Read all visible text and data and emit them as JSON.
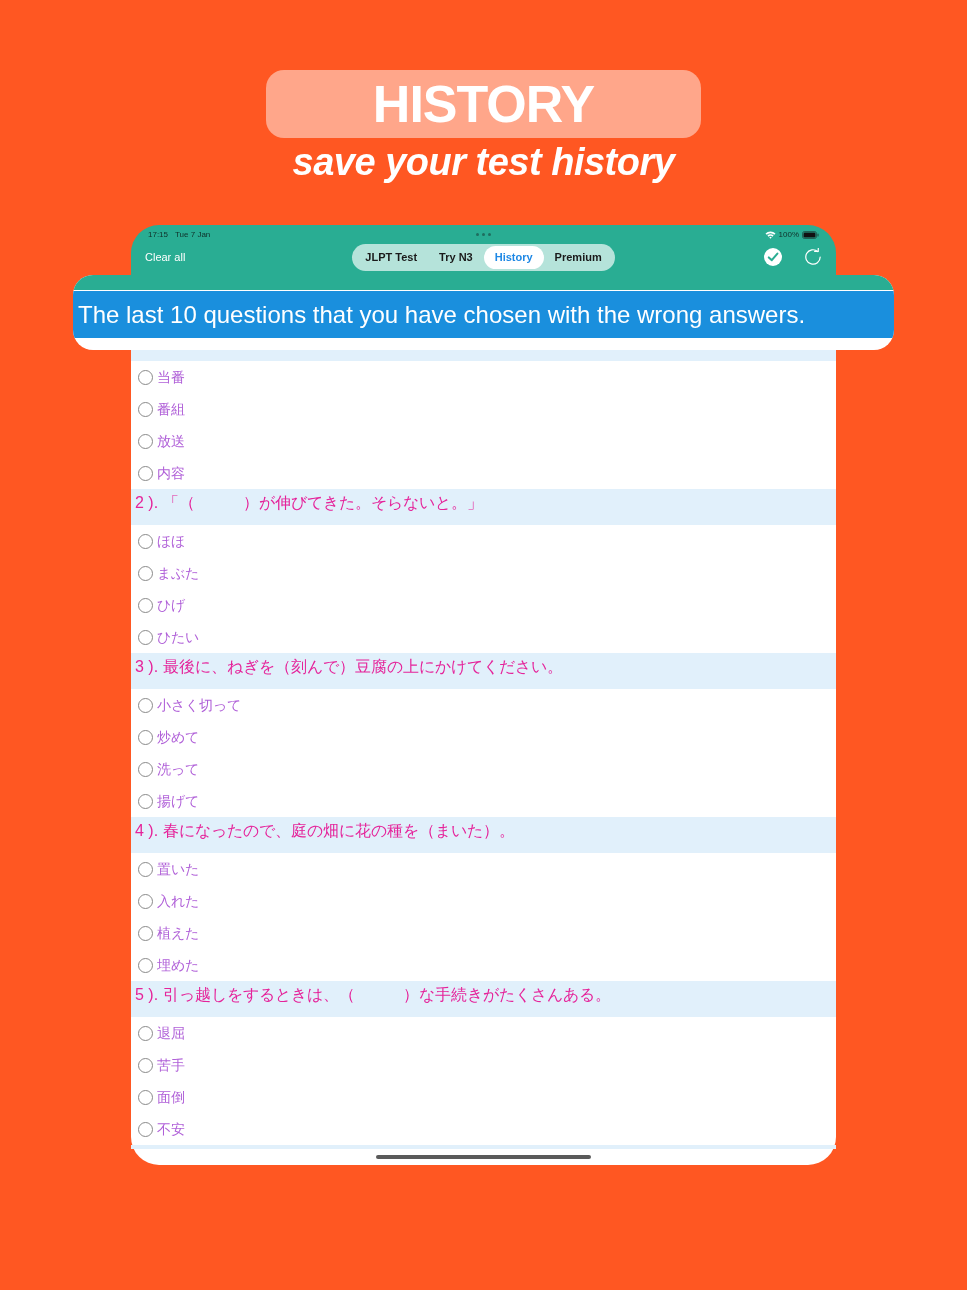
{
  "title": {
    "heading": "HISTORY",
    "subtitle": "save your test history"
  },
  "status_bar": {
    "time": "17:15",
    "date": "Tue 7 Jan",
    "battery": "100%"
  },
  "toolbar": {
    "clear_button": "Clear all",
    "tabs": [
      {
        "label": "JLPT Test",
        "selected": false
      },
      {
        "label": "Try N3",
        "selected": false
      },
      {
        "label": "History",
        "selected": true
      },
      {
        "label": "Premium",
        "selected": false
      }
    ]
  },
  "banner": {
    "text": "The last 10 questions that you have chosen with the wrong answers."
  },
  "questions": [
    {
      "options": [
        {
          "label": "当番",
          "selected": false
        },
        {
          "label": "番組",
          "selected": false
        },
        {
          "label": "放送",
          "selected": false
        },
        {
          "label": "内容",
          "selected": false
        }
      ]
    },
    {
      "prompt": "2 ). 「（　　　）が伸びてきた。そらないと。」",
      "options": [
        {
          "label": "ほほ",
          "selected": false
        },
        {
          "label": "まぶた",
          "selected": false
        },
        {
          "label": "ひげ",
          "selected": false
        },
        {
          "label": "ひたい",
          "selected": false
        }
      ]
    },
    {
      "prompt": "3 ). 最後に、ねぎを（刻んで）豆腐の上にかけてください。",
      "options": [
        {
          "label": "小さく切って",
          "selected": false
        },
        {
          "label": "炒めて",
          "selected": false
        },
        {
          "label": "洗って",
          "selected": false
        },
        {
          "label": "揚げて",
          "selected": false
        }
      ]
    },
    {
      "prompt": "4 ). 春になったので、庭の畑に花の種を（まいた）。",
      "options": [
        {
          "label": "置いた",
          "selected": false
        },
        {
          "label": "入れた",
          "selected": false
        },
        {
          "label": "植えた",
          "selected": false
        },
        {
          "label": "埋めた",
          "selected": false
        }
      ]
    },
    {
      "prompt": "5 ). 引っ越しをするときは、（　　　）な手続きがたくさんある。",
      "options": [
        {
          "label": "退屈",
          "selected": false
        },
        {
          "label": "苦手",
          "selected": false
        },
        {
          "label": "面倒",
          "selected": false
        },
        {
          "label": "不安",
          "selected": false
        }
      ]
    }
  ]
}
